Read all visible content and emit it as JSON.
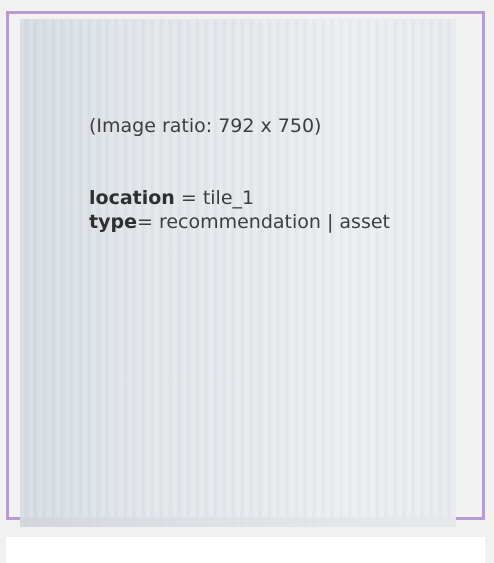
{
  "tile": {
    "image_ratio_text": "(Image ratio: 792 x 750)",
    "location": {
      "key": "location",
      "separator": " = ",
      "value": "tile_1"
    },
    "type": {
      "key": "type",
      "separator": "= ",
      "value": "recommendation | asset"
    }
  },
  "colors": {
    "tile_border": "#b99bd1",
    "text": "#3d3d3d",
    "background": "#f1f1f1"
  }
}
